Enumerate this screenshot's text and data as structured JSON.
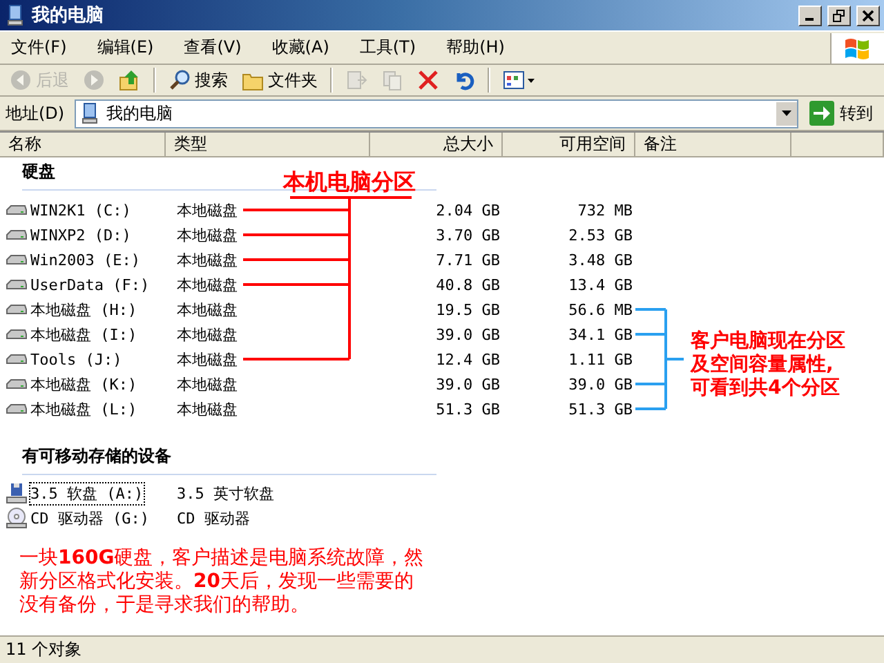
{
  "window": {
    "title": "我的电脑"
  },
  "menu": [
    "文件(F)",
    "编辑(E)",
    "查看(V)",
    "收藏(A)",
    "工具(T)",
    "帮助(H)"
  ],
  "toolbar": [
    {
      "kind": "back",
      "label": "后退",
      "disabled": true
    },
    {
      "kind": "forward",
      "disabled": true
    },
    {
      "kind": "up",
      "disabled": false
    },
    {
      "kind": "search",
      "label": "搜索",
      "disabled": false
    },
    {
      "kind": "folders",
      "label": "文件夹",
      "disabled": false
    },
    {
      "kind": "move",
      "disabled": true
    },
    {
      "kind": "copy",
      "disabled": true
    },
    {
      "kind": "delete",
      "disabled": false
    },
    {
      "kind": "undo",
      "disabled": false
    },
    {
      "kind": "views",
      "disabled": false
    }
  ],
  "address": {
    "label": "地址(D)",
    "value": "我的电脑",
    "go": "转到"
  },
  "columns": [
    "名称",
    "类型",
    "总大小",
    "可用空间",
    "备注"
  ],
  "groups": [
    {
      "title": "硬盘",
      "items": [
        {
          "kind": "disk",
          "name": "WIN2K1 (C:)",
          "type": "本地磁盘",
          "total": "2.04 GB",
          "free": "732 MB",
          "focused": false,
          "partition_line": true,
          "customer_line": false
        },
        {
          "kind": "disk",
          "name": "WINXP2 (D:)",
          "type": "本地磁盘",
          "total": "3.70 GB",
          "free": "2.53 GB",
          "focused": false,
          "partition_line": true,
          "customer_line": false
        },
        {
          "kind": "disk",
          "name": "Win2003 (E:)",
          "type": "本地磁盘",
          "total": "7.71 GB",
          "free": "3.48 GB",
          "focused": false,
          "partition_line": true,
          "customer_line": false
        },
        {
          "kind": "disk",
          "name": "UserData (F:)",
          "type": "本地磁盘",
          "total": "40.8 GB",
          "free": "13.4 GB",
          "focused": false,
          "partition_line": true,
          "customer_line": false
        },
        {
          "kind": "disk",
          "name": "本地磁盘 (H:)",
          "type": "本地磁盘",
          "total": "19.5 GB",
          "free": "56.6 MB",
          "focused": false,
          "partition_line": false,
          "customer_line": true
        },
        {
          "kind": "disk",
          "name": "本地磁盘 (I:)",
          "type": "本地磁盘",
          "total": "39.0 GB",
          "free": "34.1 GB",
          "focused": false,
          "partition_line": false,
          "customer_line": true
        },
        {
          "kind": "disk",
          "name": "Tools (J:)",
          "type": "本地磁盘",
          "total": "12.4 GB",
          "free": "1.11 GB",
          "focused": false,
          "partition_line": true,
          "customer_line": false
        },
        {
          "kind": "disk",
          "name": "本地磁盘 (K:)",
          "type": "本地磁盘",
          "total": "39.0 GB",
          "free": "39.0 GB",
          "focused": false,
          "partition_line": false,
          "customer_line": true
        },
        {
          "kind": "disk",
          "name": "本地磁盘 (L:)",
          "type": "本地磁盘",
          "total": "51.3 GB",
          "free": "51.3 GB",
          "focused": false,
          "partition_line": false,
          "customer_line": true
        }
      ]
    },
    {
      "title": "有可移动存储的设备",
      "items": [
        {
          "kind": "floppy",
          "name": "3.5 软盘 (A:)",
          "type": "3.5 英寸软盘",
          "focused": true
        },
        {
          "kind": "cd",
          "name": "CD 驱动器 (G:)",
          "type": "CD 驱动器",
          "focused": false
        }
      ]
    }
  ],
  "annotations": {
    "partition_label": "本机电脑分区",
    "customer_label": [
      "客户电脑现在分区",
      "及空间容量属性,",
      "可看到共**4**个分区"
    ],
    "note": [
      "一块**160G**硬盘，客户描述是电脑系统故障，然",
      "新分区格式化安装。**20**天后，发现一些需要的",
      "没有备份，于是寻求我们的帮助。"
    ]
  },
  "status_bar": "11 个对象"
}
